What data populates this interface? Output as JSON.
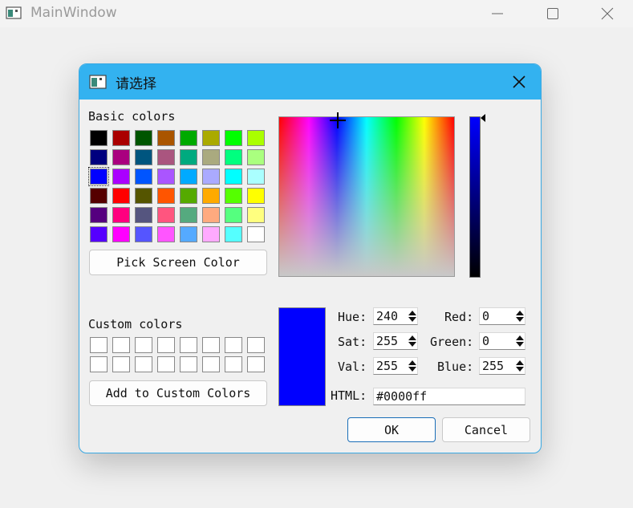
{
  "main_window": {
    "title": "MainWindow"
  },
  "dialog": {
    "title": "请选择",
    "basic_colors_label": "Basic colors",
    "basic_colors": [
      "#000000",
      "#aa0000",
      "#005500",
      "#aa5500",
      "#00aa00",
      "#aaaa00",
      "#00ff00",
      "#aaff00",
      "#00007f",
      "#aa007f",
      "#00557f",
      "#aa557f",
      "#00aa7f",
      "#aaaa7f",
      "#00ff7f",
      "#aaff7f",
      "#0000ff",
      "#aa00ff",
      "#0055ff",
      "#aa55ff",
      "#00aaff",
      "#aaaaff",
      "#00ffff",
      "#aaffff",
      "#550000",
      "#ff0000",
      "#555500",
      "#ff5500",
      "#55aa00",
      "#ffaa00",
      "#55ff00",
      "#ffff00",
      "#55007f",
      "#ff007f",
      "#55557f",
      "#ff557f",
      "#55aa7f",
      "#ffaa7f",
      "#55ff7f",
      "#ffff7f",
      "#5500ff",
      "#ff00ff",
      "#5555ff",
      "#ff55ff",
      "#55aaff",
      "#ffaaff",
      "#55ffff",
      "#ffffff"
    ],
    "selected_basic_index": 16,
    "pick_screen_color": "Pick Screen Color",
    "custom_colors_label": "Custom colors",
    "add_custom": "Add to Custom Colors",
    "current_color": "#0000ff",
    "fields": {
      "hue_label": "Hue:",
      "hue": "240",
      "sat_label": "Sat:",
      "sat": "255",
      "val_label": "Val:",
      "val": "255",
      "red_label": "Red:",
      "red": "0",
      "green_label": "Green:",
      "green": "0",
      "blue_label": "Blue:",
      "blue": "255",
      "html_label": "HTML:",
      "html": "#0000ff"
    },
    "ok": "OK",
    "cancel": "Cancel"
  },
  "colors": {
    "titlebar": "#33b2f0",
    "accent_border": "#1a6eb8"
  }
}
